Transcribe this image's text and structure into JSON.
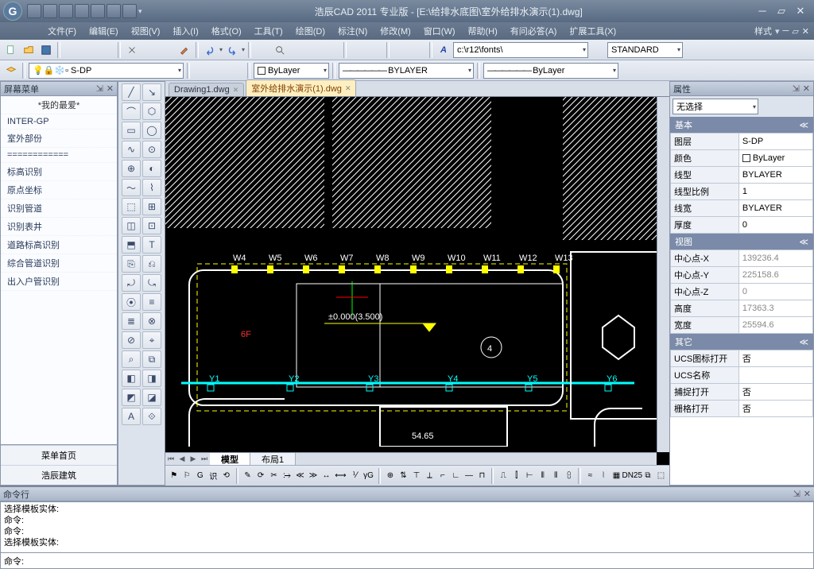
{
  "title": "浩辰CAD 2011 专业版 - [E:\\给排水底图\\室外给排水演示(1).dwg]",
  "menus": [
    "文件(F)",
    "编辑(E)",
    "视图(V)",
    "插入(I)",
    "格式(O)",
    "工具(T)",
    "绘图(D)",
    "标注(N)",
    "修改(M)",
    "窗口(W)",
    "帮助(H)",
    "有问必答(A)",
    "扩展工具(X)"
  ],
  "style_label": "样式",
  "font_path": "c:\\r12\\fonts\\",
  "text_style": "STANDARD",
  "layer_combo": "S-DP",
  "bylayer_color": "ByLayer",
  "bylayer_lt": "BYLAYER",
  "bylayer_lw": "ByLayer",
  "left_panel": {
    "title": "屏幕菜单",
    "favorites": "*我的最爱*",
    "items": [
      "INTER-GP",
      "室外部份",
      "============",
      "标高识别",
      "原点坐标",
      "识别管道",
      "识别表井",
      "道路标高识别",
      "综合管道识别",
      "出入户管识别"
    ],
    "footer": [
      "菜单首页",
      "浩辰建筑"
    ]
  },
  "file_tabs": [
    {
      "label": "Drawing1.dwg",
      "active": false
    },
    {
      "label": "室外给排水演示(1).dwg",
      "active": true
    }
  ],
  "model_tabs": {
    "model": "模型",
    "layout": "布局1"
  },
  "drawing": {
    "w_labels": [
      "W4",
      "W5",
      "W6",
      "W7",
      "W8",
      "W9",
      "W10",
      "W11",
      "W12",
      "W13"
    ],
    "y_labels": [
      "Y1",
      "Y2",
      "Y3",
      "Y4",
      "Y5",
      "Y6"
    ],
    "text_6f": "6F",
    "text_elev": "±0.000(3.500)",
    "text_bottom": "54.65",
    "circle_num": "4"
  },
  "props": {
    "title": "属性",
    "sel": "无选择",
    "sections": {
      "basic": {
        "hdr": "基本",
        "rows": [
          {
            "k": "图层",
            "v": "S-DP"
          },
          {
            "k": "颜色",
            "v": "ByLayer",
            "sw": true
          },
          {
            "k": "线型",
            "v": "BYLAYER"
          },
          {
            "k": "线型比例",
            "v": "1"
          },
          {
            "k": "线宽",
            "v": "BYLAYER"
          },
          {
            "k": "厚度",
            "v": "0"
          }
        ]
      },
      "view": {
        "hdr": "视图",
        "rows": [
          {
            "k": "中心点-X",
            "v": "139236.4",
            "ro": true
          },
          {
            "k": "中心点-Y",
            "v": "225158.6",
            "ro": true
          },
          {
            "k": "中心点-Z",
            "v": "0",
            "ro": true
          },
          {
            "k": "高度",
            "v": "17363.3",
            "ro": true
          },
          {
            "k": "宽度",
            "v": "25594.6",
            "ro": true
          }
        ]
      },
      "other": {
        "hdr": "其它",
        "rows": [
          {
            "k": "UCS图标打开",
            "v": "否"
          },
          {
            "k": "UCS名称",
            "v": ""
          },
          {
            "k": "捕捉打开",
            "v": "否"
          },
          {
            "k": "栅格打开",
            "v": "否"
          }
        ]
      }
    }
  },
  "cmdline": {
    "title": "命令行",
    "log": [
      "选择模板实体:",
      "命令:",
      "命令:",
      "选择模板实体:"
    ],
    "prompt": "命令:"
  }
}
